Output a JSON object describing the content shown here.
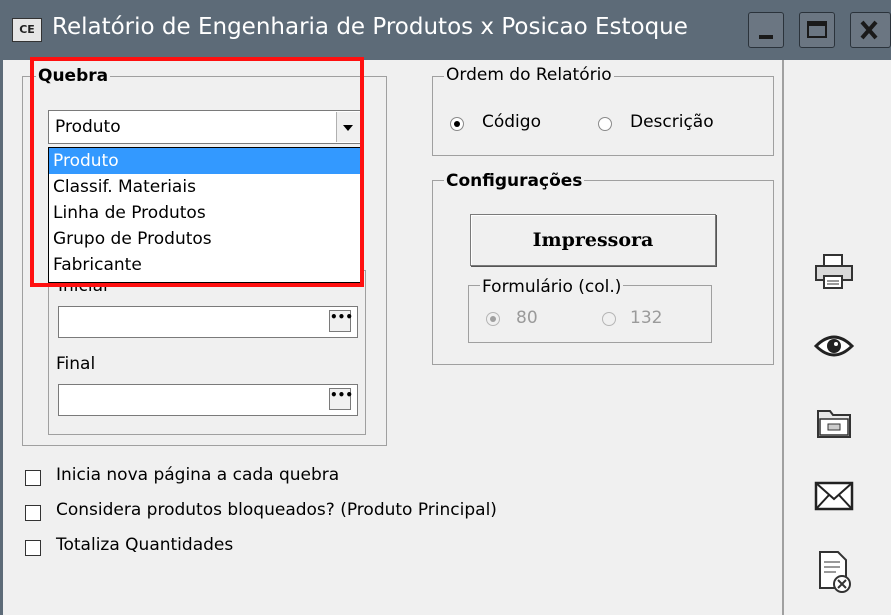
{
  "window": {
    "title": "Relatório de Engenharia de Produtos x Posicao Estoque",
    "app_icon": "CE",
    "icons": [
      "minimize-icon",
      "maximize-icon",
      "close-icon"
    ]
  },
  "quebra": {
    "label": "Quebra",
    "selected": "Produto",
    "options": [
      "Produto",
      "Classif. Materiais",
      "Linha de Produtos",
      "Grupo de Produtos",
      "Fabricante"
    ],
    "inicial_label": "Inicial",
    "inicial_value": "",
    "final_label": "Final",
    "final_value": ""
  },
  "ordem": {
    "label": "Ordem do Relatório",
    "options": [
      "Código",
      "Descrição"
    ],
    "selected": "Código"
  },
  "config": {
    "label": "Configurações",
    "printer_button": "Impressora",
    "formulario_label": "Formulário (col.)",
    "formulario_options": [
      "80",
      "132"
    ],
    "formulario_selected": "80"
  },
  "checkboxes": [
    {
      "label": "Inicia nova página a cada quebra",
      "checked": false
    },
    {
      "label": "Considera produtos bloqueados? (Produto Principal)",
      "checked": false
    },
    {
      "label": "Totaliza Quantidades",
      "checked": false
    }
  ],
  "sidebar_icons": [
    "printer-icon",
    "eye-icon",
    "folder-icon",
    "envelope-icon",
    "document-cancel-icon"
  ],
  "colors": {
    "titlebar": "#5d6b78",
    "highlight": "#3399ff",
    "annotation": "#ff1010"
  }
}
